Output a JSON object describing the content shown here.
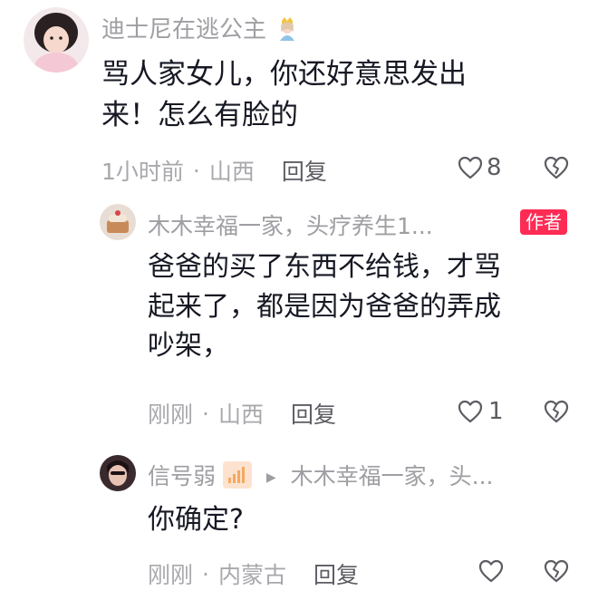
{
  "comments": [
    {
      "username": "迪士尼在逃公主",
      "badge": "princess-emoji-icon",
      "content_lines": [
        "骂人家女儿，你还好意思发出",
        "来！怎么有脸的"
      ],
      "time": "1小时前",
      "location": "山西",
      "reply_label": "回复",
      "likes": "8"
    },
    {
      "username": "木木幸福一家，头疗养生1...",
      "author_badge": "作者",
      "content_lines": [
        "爸爸的买了东西不给钱，才骂",
        "起来了，都是因为爸爸的弄成",
        "吵架，"
      ],
      "time": "刚刚",
      "location": "山西",
      "reply_label": "回复",
      "likes": "1"
    },
    {
      "username": "信号弱",
      "badge": "signal-bars-icon",
      "reply_to": "木木幸福一家，头...",
      "content_lines": [
        "你确定?"
      ],
      "time": "刚刚",
      "location": "内蒙古",
      "reply_label": "回复",
      "likes": ""
    }
  ],
  "colors": {
    "text": "#161823",
    "meta": "#a8a8ad",
    "author_badge": "#fe2c55"
  }
}
